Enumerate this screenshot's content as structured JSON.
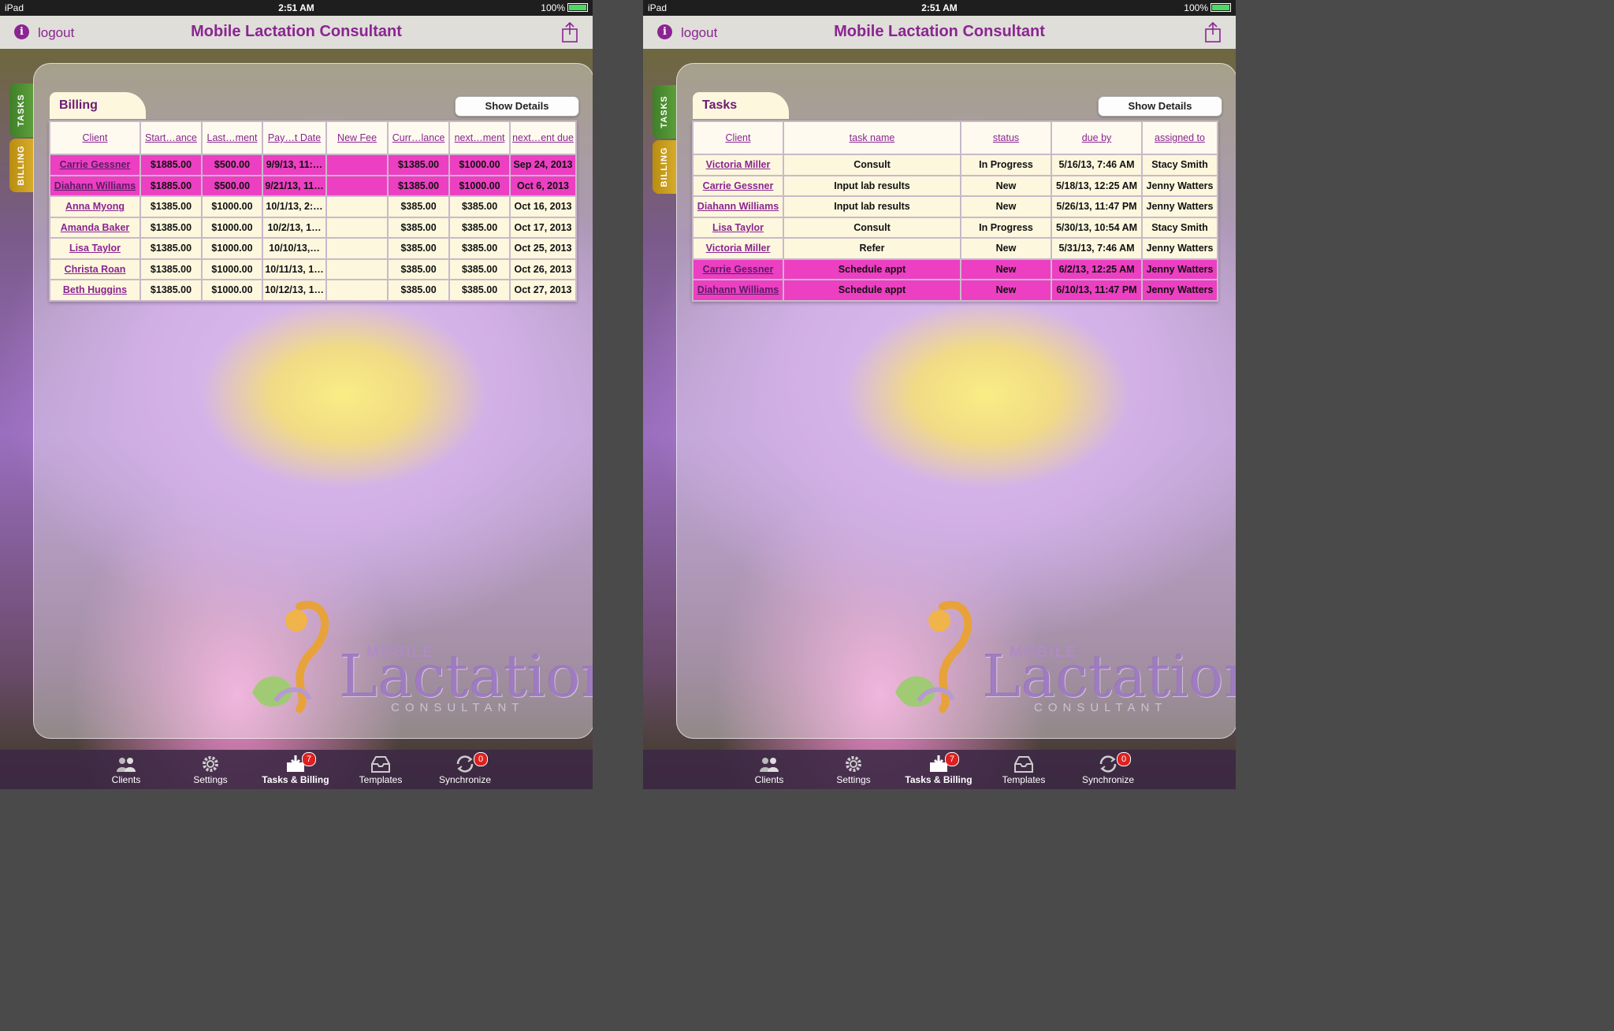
{
  "status_bar": {
    "carrier": "iPad",
    "time": "2:51 AM",
    "battery": "100%"
  },
  "nav": {
    "logout": "logout",
    "title": "Mobile Lactation Consultant"
  },
  "side_tabs": {
    "tasks": "TASKS",
    "billing": "BILLING"
  },
  "show_details": "Show Details",
  "billing": {
    "title": "Billing",
    "columns": [
      "Client",
      "Start…ance",
      "Last…ment",
      "Pay…t Date",
      "New Fee",
      "Curr…lance",
      "next…ment",
      "next…ent due"
    ],
    "rows": [
      {
        "highlight": true,
        "cells": [
          "Carrie Gessner",
          "$1885.00",
          "$500.00",
          "9/9/13, 11:…",
          "",
          "$1385.00",
          "$1000.00",
          "Sep 24, 2013"
        ]
      },
      {
        "highlight": true,
        "cells": [
          "Diahann Williams",
          "$1885.00",
          "$500.00",
          "9/21/13, 11…",
          "",
          "$1385.00",
          "$1000.00",
          "Oct 6, 2013"
        ]
      },
      {
        "highlight": false,
        "cells": [
          "Anna Myong",
          "$1385.00",
          "$1000.00",
          "10/1/13, 2:…",
          "",
          "$385.00",
          "$385.00",
          "Oct 16, 2013"
        ]
      },
      {
        "highlight": false,
        "cells": [
          "Amanda Baker",
          "$1385.00",
          "$1000.00",
          "10/2/13, 1…",
          "",
          "$385.00",
          "$385.00",
          "Oct 17, 2013"
        ]
      },
      {
        "highlight": false,
        "cells": [
          "Lisa Taylor",
          "$1385.00",
          "$1000.00",
          "10/10/13,…",
          "",
          "$385.00",
          "$385.00",
          "Oct 25, 2013"
        ]
      },
      {
        "highlight": false,
        "cells": [
          "Christa Roan",
          "$1385.00",
          "$1000.00",
          "10/11/13, 1…",
          "",
          "$385.00",
          "$385.00",
          "Oct 26, 2013"
        ]
      },
      {
        "highlight": false,
        "cells": [
          "Beth Huggins",
          "$1385.00",
          "$1000.00",
          "10/12/13, 1…",
          "",
          "$385.00",
          "$385.00",
          "Oct 27, 2013"
        ]
      }
    ]
  },
  "tasks": {
    "title": "Tasks",
    "columns": [
      "Client",
      "task name",
      "status",
      "due by",
      "assigned to"
    ],
    "rows": [
      {
        "highlight": false,
        "cells": [
          "Victoria Miller",
          "Consult",
          "In Progress",
          "5/16/13, 7:46 AM",
          "Stacy Smith"
        ]
      },
      {
        "highlight": false,
        "cells": [
          "Carrie Gessner",
          "Input lab results",
          "New",
          "5/18/13, 12:25 AM",
          "Jenny Watters"
        ]
      },
      {
        "highlight": false,
        "cells": [
          "Diahann Williams",
          "Input lab results",
          "New",
          "5/26/13, 11:47 PM",
          "Jenny Watters"
        ]
      },
      {
        "highlight": false,
        "cells": [
          "Lisa Taylor",
          "Consult",
          "In Progress",
          "5/30/13, 10:54 AM",
          "Stacy Smith"
        ]
      },
      {
        "highlight": false,
        "cells": [
          "Victoria Miller",
          "Refer",
          "New",
          "5/31/13, 7:46 AM",
          "Jenny Watters"
        ]
      },
      {
        "highlight": true,
        "cells": [
          "Carrie Gessner",
          "Schedule appt",
          "New",
          "6/2/13, 12:25 AM",
          "Jenny Watters"
        ]
      },
      {
        "highlight": true,
        "cells": [
          "Diahann Williams",
          "Schedule appt",
          "New",
          "6/10/13, 11:47 PM",
          "Jenny Watters"
        ]
      }
    ]
  },
  "logo": {
    "line1": "MOBILE",
    "line2": "Lactation",
    "line3": "CONSULTANT"
  },
  "tabbar": {
    "clients": "Clients",
    "settings": "Settings",
    "tasks_billing": "Tasks & Billing",
    "tasks_billing_badge": "7",
    "templates": "Templates",
    "synchronize": "Synchronize",
    "synchronize_badge": "0"
  },
  "colors": {
    "accent": "#8a2591",
    "highlight_row": "#ec3fc2",
    "table_bg": "#fdf7de"
  }
}
